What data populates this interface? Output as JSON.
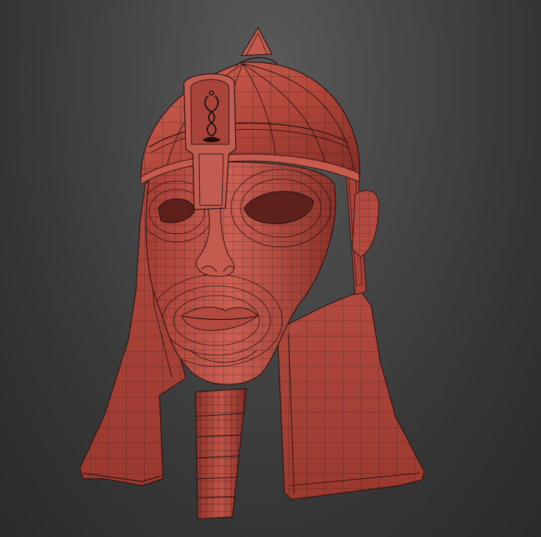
{
  "viewport": {
    "background_color": "#3a3a3a",
    "subject": "3d-helmet-head-wireframe"
  },
  "colors": {
    "mesh_base": "#b8473d",
    "mesh_dark": "#7a2a24",
    "mesh_light": "#d2665a",
    "wire": "#1e0e0c"
  }
}
